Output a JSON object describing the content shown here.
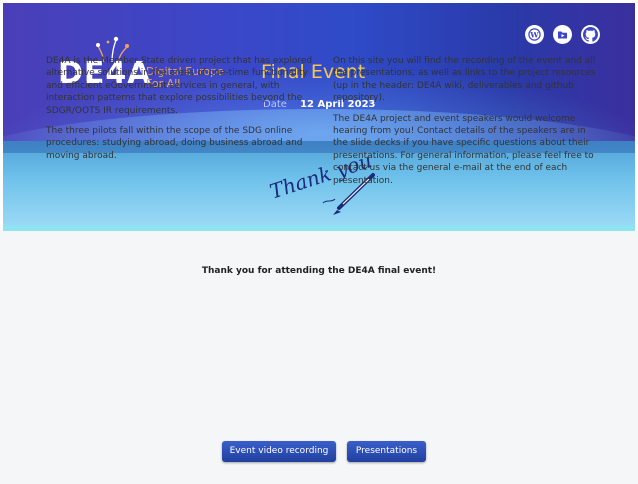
{
  "header": {
    "logo_text": "DE4A",
    "logo_subtitle_line1": "Digital Europe",
    "logo_subtitle_line2": "For All",
    "event_title": "Final Event",
    "date_label": "Date",
    "date_value": "12 April 2023",
    "icons": [
      "wiki-icon",
      "deliverables-icon",
      "github-icon"
    ]
  },
  "banner": {
    "thank_you_text": "Thank you"
  },
  "main": {
    "heading": "Thank you for attending the DE4A final event!",
    "left_paragraphs": [
      "DE4A is the Member State driven project that has explored alternative solutions in the areas of one-time functionality and efficient eGovernment services in general, with interaction patterns that explore possibilities beyond the SDGR/OOTS IR requirements.",
      "The three pilots fall within the scope of the SDG online procedures: studying abroad, doing business abroad and moving abroad."
    ],
    "right_paragraphs": [
      "On this site you will find the recording of the event and all the presentations, as well as links to the project resources (up in the header: DE4A wiki, deliverables and github repository).",
      "The DE4A project and event speakers would welcome hearing from you! Contact details of the speakers are in the slide decks if you have specific questions about their presentations. For general information, please feel free to contact us via the general e-mail at the end of each presentation."
    ],
    "buttons": {
      "video_label": "Event video recording",
      "presentations_label": "Presentations"
    }
  },
  "colors": {
    "header_blue": "#3b47c9",
    "title_gold": "#f2c94c",
    "logo_orange": "#f0a45a",
    "button_blue": "#2a4bb3"
  }
}
